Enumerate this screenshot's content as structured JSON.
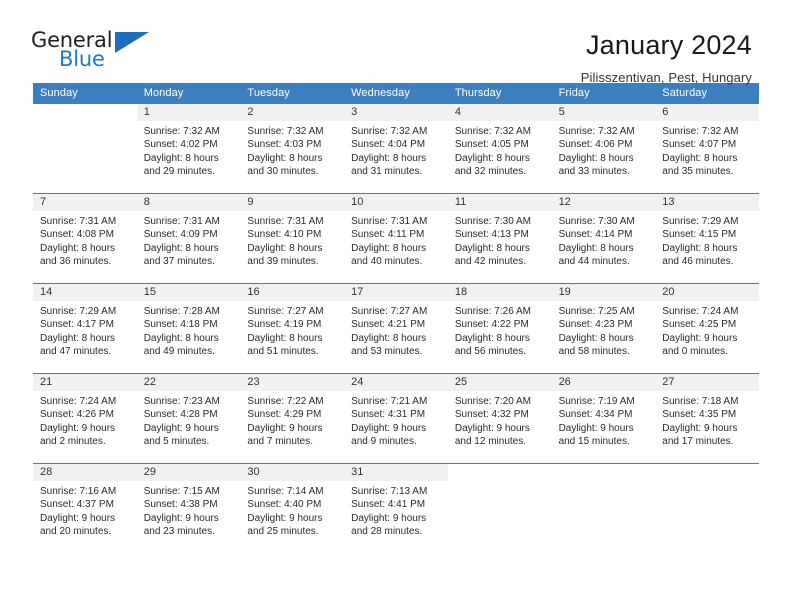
{
  "logo": {
    "word_top": "General",
    "word_bottom": "Blue",
    "triangle": "triangle-icon",
    "accent_color": "#2079c4"
  },
  "header": {
    "title": "January 2024",
    "subtitle": "Pilisszentivan, Pest, Hungary"
  },
  "calendar": {
    "header_bg": "#3c7fc0",
    "daynum_bg": "#f1f1f1",
    "weekdays": [
      "Sunday",
      "Monday",
      "Tuesday",
      "Wednesday",
      "Thursday",
      "Friday",
      "Saturday"
    ],
    "weeks": [
      [
        {
          "day": ""
        },
        {
          "day": "1",
          "sunrise": "Sunrise: 7:32 AM",
          "sunset": "Sunset: 4:02 PM",
          "daylight_1": "Daylight: 8 hours",
          "daylight_2": "and 29 minutes."
        },
        {
          "day": "2",
          "sunrise": "Sunrise: 7:32 AM",
          "sunset": "Sunset: 4:03 PM",
          "daylight_1": "Daylight: 8 hours",
          "daylight_2": "and 30 minutes."
        },
        {
          "day": "3",
          "sunrise": "Sunrise: 7:32 AM",
          "sunset": "Sunset: 4:04 PM",
          "daylight_1": "Daylight: 8 hours",
          "daylight_2": "and 31 minutes."
        },
        {
          "day": "4",
          "sunrise": "Sunrise: 7:32 AM",
          "sunset": "Sunset: 4:05 PM",
          "daylight_1": "Daylight: 8 hours",
          "daylight_2": "and 32 minutes."
        },
        {
          "day": "5",
          "sunrise": "Sunrise: 7:32 AM",
          "sunset": "Sunset: 4:06 PM",
          "daylight_1": "Daylight: 8 hours",
          "daylight_2": "and 33 minutes."
        },
        {
          "day": "6",
          "sunrise": "Sunrise: 7:32 AM",
          "sunset": "Sunset: 4:07 PM",
          "daylight_1": "Daylight: 8 hours",
          "daylight_2": "and 35 minutes."
        }
      ],
      [
        {
          "day": "7",
          "sunrise": "Sunrise: 7:31 AM",
          "sunset": "Sunset: 4:08 PM",
          "daylight_1": "Daylight: 8 hours",
          "daylight_2": "and 36 minutes."
        },
        {
          "day": "8",
          "sunrise": "Sunrise: 7:31 AM",
          "sunset": "Sunset: 4:09 PM",
          "daylight_1": "Daylight: 8 hours",
          "daylight_2": "and 37 minutes."
        },
        {
          "day": "9",
          "sunrise": "Sunrise: 7:31 AM",
          "sunset": "Sunset: 4:10 PM",
          "daylight_1": "Daylight: 8 hours",
          "daylight_2": "and 39 minutes."
        },
        {
          "day": "10",
          "sunrise": "Sunrise: 7:31 AM",
          "sunset": "Sunset: 4:11 PM",
          "daylight_1": "Daylight: 8 hours",
          "daylight_2": "and 40 minutes."
        },
        {
          "day": "11",
          "sunrise": "Sunrise: 7:30 AM",
          "sunset": "Sunset: 4:13 PM",
          "daylight_1": "Daylight: 8 hours",
          "daylight_2": "and 42 minutes."
        },
        {
          "day": "12",
          "sunrise": "Sunrise: 7:30 AM",
          "sunset": "Sunset: 4:14 PM",
          "daylight_1": "Daylight: 8 hours",
          "daylight_2": "and 44 minutes."
        },
        {
          "day": "13",
          "sunrise": "Sunrise: 7:29 AM",
          "sunset": "Sunset: 4:15 PM",
          "daylight_1": "Daylight: 8 hours",
          "daylight_2": "and 46 minutes."
        }
      ],
      [
        {
          "day": "14",
          "sunrise": "Sunrise: 7:29 AM",
          "sunset": "Sunset: 4:17 PM",
          "daylight_1": "Daylight: 8 hours",
          "daylight_2": "and 47 minutes."
        },
        {
          "day": "15",
          "sunrise": "Sunrise: 7:28 AM",
          "sunset": "Sunset: 4:18 PM",
          "daylight_1": "Daylight: 8 hours",
          "daylight_2": "and 49 minutes."
        },
        {
          "day": "16",
          "sunrise": "Sunrise: 7:27 AM",
          "sunset": "Sunset: 4:19 PM",
          "daylight_1": "Daylight: 8 hours",
          "daylight_2": "and 51 minutes."
        },
        {
          "day": "17",
          "sunrise": "Sunrise: 7:27 AM",
          "sunset": "Sunset: 4:21 PM",
          "daylight_1": "Daylight: 8 hours",
          "daylight_2": "and 53 minutes."
        },
        {
          "day": "18",
          "sunrise": "Sunrise: 7:26 AM",
          "sunset": "Sunset: 4:22 PM",
          "daylight_1": "Daylight: 8 hours",
          "daylight_2": "and 56 minutes."
        },
        {
          "day": "19",
          "sunrise": "Sunrise: 7:25 AM",
          "sunset": "Sunset: 4:23 PM",
          "daylight_1": "Daylight: 8 hours",
          "daylight_2": "and 58 minutes."
        },
        {
          "day": "20",
          "sunrise": "Sunrise: 7:24 AM",
          "sunset": "Sunset: 4:25 PM",
          "daylight_1": "Daylight: 9 hours",
          "daylight_2": "and 0 minutes."
        }
      ],
      [
        {
          "day": "21",
          "sunrise": "Sunrise: 7:24 AM",
          "sunset": "Sunset: 4:26 PM",
          "daylight_1": "Daylight: 9 hours",
          "daylight_2": "and 2 minutes."
        },
        {
          "day": "22",
          "sunrise": "Sunrise: 7:23 AM",
          "sunset": "Sunset: 4:28 PM",
          "daylight_1": "Daylight: 9 hours",
          "daylight_2": "and 5 minutes."
        },
        {
          "day": "23",
          "sunrise": "Sunrise: 7:22 AM",
          "sunset": "Sunset: 4:29 PM",
          "daylight_1": "Daylight: 9 hours",
          "daylight_2": "and 7 minutes."
        },
        {
          "day": "24",
          "sunrise": "Sunrise: 7:21 AM",
          "sunset": "Sunset: 4:31 PM",
          "daylight_1": "Daylight: 9 hours",
          "daylight_2": "and 9 minutes."
        },
        {
          "day": "25",
          "sunrise": "Sunrise: 7:20 AM",
          "sunset": "Sunset: 4:32 PM",
          "daylight_1": "Daylight: 9 hours",
          "daylight_2": "and 12 minutes."
        },
        {
          "day": "26",
          "sunrise": "Sunrise: 7:19 AM",
          "sunset": "Sunset: 4:34 PM",
          "daylight_1": "Daylight: 9 hours",
          "daylight_2": "and 15 minutes."
        },
        {
          "day": "27",
          "sunrise": "Sunrise: 7:18 AM",
          "sunset": "Sunset: 4:35 PM",
          "daylight_1": "Daylight: 9 hours",
          "daylight_2": "and 17 minutes."
        }
      ],
      [
        {
          "day": "28",
          "sunrise": "Sunrise: 7:16 AM",
          "sunset": "Sunset: 4:37 PM",
          "daylight_1": "Daylight: 9 hours",
          "daylight_2": "and 20 minutes."
        },
        {
          "day": "29",
          "sunrise": "Sunrise: 7:15 AM",
          "sunset": "Sunset: 4:38 PM",
          "daylight_1": "Daylight: 9 hours",
          "daylight_2": "and 23 minutes."
        },
        {
          "day": "30",
          "sunrise": "Sunrise: 7:14 AM",
          "sunset": "Sunset: 4:40 PM",
          "daylight_1": "Daylight: 9 hours",
          "daylight_2": "and 25 minutes."
        },
        {
          "day": "31",
          "sunrise": "Sunrise: 7:13 AM",
          "sunset": "Sunset: 4:41 PM",
          "daylight_1": "Daylight: 9 hours",
          "daylight_2": "and 28 minutes."
        },
        {
          "day": ""
        },
        {
          "day": ""
        },
        {
          "day": ""
        }
      ]
    ]
  }
}
